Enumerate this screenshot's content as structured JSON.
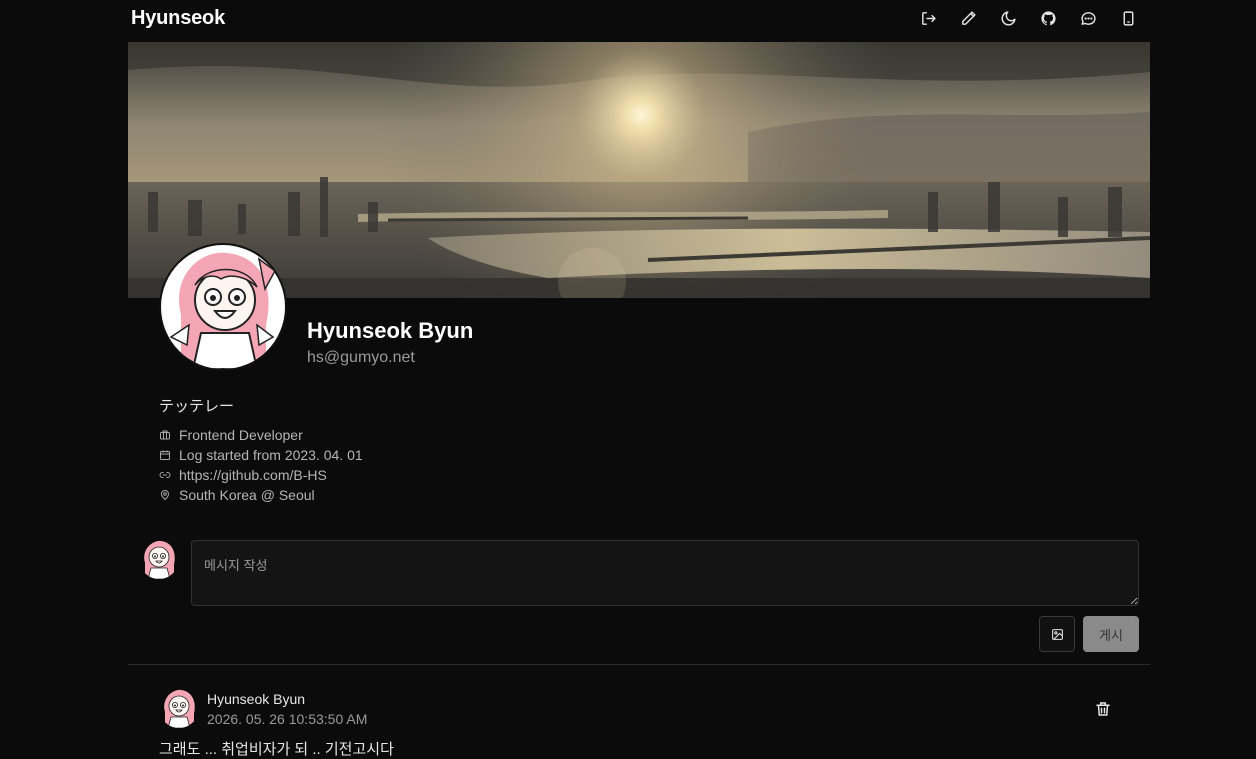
{
  "app": {
    "brand": "Hyunseok"
  },
  "nav": {
    "icons": [
      "logout-icon",
      "pencil-icon",
      "moon-icon",
      "github-icon",
      "chat-icon",
      "book-icon"
    ]
  },
  "profile": {
    "name": "Hyunseok Byun",
    "email": "hs@gumyo.net",
    "bio": "テッテレー",
    "meta": [
      {
        "icon": "briefcase-icon",
        "text": "Frontend Developer"
      },
      {
        "icon": "calendar-icon",
        "text": "Log started from 2023. 04. 01"
      },
      {
        "icon": "link-icon",
        "text": "https://github.com/B-HS"
      },
      {
        "icon": "map-pin-icon",
        "text": "South Korea @ Seoul"
      }
    ]
  },
  "compose": {
    "placeholder": "메시지 작성",
    "post_label": "게시"
  },
  "posts": [
    {
      "author": "Hyunseok Byun",
      "time": "2026. 05. 26 10:53:50 AM",
      "body": "그래도 ... 취업비자가 되 .. 기전고시다"
    }
  ],
  "colors": {
    "background": "#0b0b0b",
    "post_button": "#8a8a8a",
    "avatar_hair": "#f4a6b5"
  }
}
